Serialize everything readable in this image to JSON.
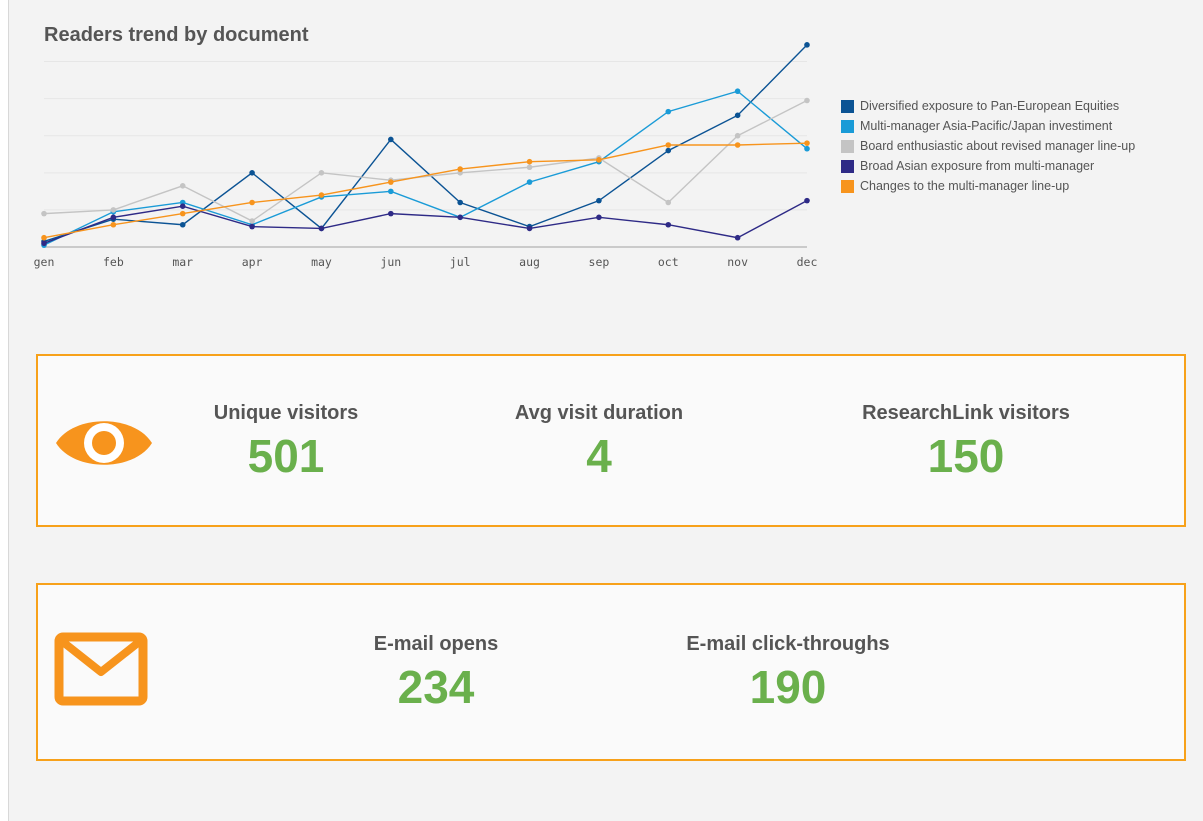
{
  "chart_data": {
    "type": "line",
    "title": "Readers trend by document",
    "categories": [
      "gen",
      "feb",
      "mar",
      "apr",
      "may",
      "jun",
      "jul",
      "aug",
      "sep",
      "oct",
      "nov",
      "dec"
    ],
    "ylim": [
      0,
      11
    ],
    "grid": true,
    "legend_position": "right",
    "series": [
      {
        "name": "Diversified exposure to Pan-European Equities",
        "color": "#0b5394",
        "values": [
          0.3,
          1.5,
          1.2,
          4.0,
          1.0,
          5.8,
          2.4,
          1.1,
          2.5,
          5.2,
          7.1,
          10.9
        ]
      },
      {
        "name": "Multi-manager Asia-Pacific/Japan investiment",
        "color": "#1a9bd7",
        "values": [
          0.1,
          1.9,
          2.4,
          1.2,
          2.7,
          3.0,
          1.6,
          3.5,
          4.6,
          7.3,
          8.4,
          5.3
        ]
      },
      {
        "name": "Board enthusiastic about revised manager line-up",
        "color": "#c4c4c4",
        "values": [
          1.8,
          2.0,
          3.3,
          1.4,
          4.0,
          3.6,
          4.0,
          4.3,
          4.8,
          2.4,
          6.0,
          7.9
        ]
      },
      {
        "name": "Broad Asian exposure from multi-manager",
        "color": "#2e2a86",
        "values": [
          0.2,
          1.6,
          2.2,
          1.1,
          1.0,
          1.8,
          1.6,
          1.0,
          1.6,
          1.2,
          0.5,
          2.5
        ]
      },
      {
        "name": "Changes to the multi-manager line-up",
        "color": "#f7941d",
        "values": [
          0.5,
          1.2,
          1.8,
          2.4,
          2.8,
          3.5,
          4.2,
          4.6,
          4.7,
          5.5,
          5.5,
          5.6
        ]
      }
    ]
  },
  "kpis": {
    "unique_visitors": {
      "label": "Unique visitors",
      "value": "501"
    },
    "avg_visit_duration": {
      "label": "Avg visit duration",
      "value": "4"
    },
    "researchlink_visitors": {
      "label": "ResearchLink visitors",
      "value": "150"
    },
    "email_opens": {
      "label": "E-mail opens",
      "value": "234"
    },
    "email_clickthroughs": {
      "label": "E-mail click-throughs",
      "value": "190"
    }
  },
  "icons": {
    "visitors_icon": "eye-icon",
    "email_icon": "mail-icon",
    "accent_color": "#f7941d",
    "value_color": "#6ab04c"
  }
}
